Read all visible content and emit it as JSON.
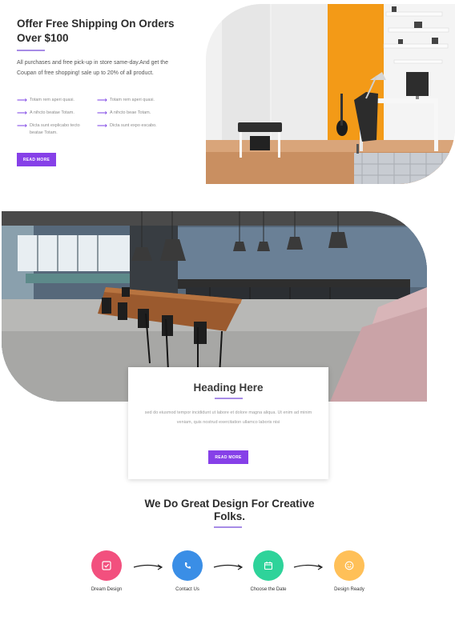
{
  "promo": {
    "title": "Offer Free Shipping On Orders Over $100",
    "description": "All purchases and free pick-up in store same-day.And get the Coupan of free shopping! sale up to 20% of all product.",
    "features": [
      {
        "text": "Totam rem aperi quasi."
      },
      {
        "text": "Totam rem aperi quasi."
      },
      {
        "text": "A nihcto beatae Totam."
      },
      {
        "text": "A nihcto beae Totam."
      },
      {
        "text": "Dicta sunt explicabo tecto beatae Totam."
      },
      {
        "text": "Dicta sunt expo escabo."
      }
    ],
    "button_label": "READ MORE"
  },
  "feature_card": {
    "title": "Heading Here",
    "text": "sed do eiusmod tempor incididunt ut labore et dolore magna aliqua. Ut enim ad minim veniam, quis nostrud exercitation ullamco laboris nisi",
    "button_label": "READ MORE"
  },
  "process": {
    "title": "We Do Great Design For Creative Folks.",
    "steps": [
      {
        "label": "Dream Design",
        "icon": "checkbox-icon",
        "color": "#f2507e"
      },
      {
        "label": "Contact Us",
        "icon": "phone-icon",
        "color": "#3a8ee6"
      },
      {
        "label": "Choose the Date",
        "icon": "calendar-icon",
        "color": "#2ed39a"
      },
      {
        "label": "Design Ready",
        "icon": "smile-icon",
        "color": "#ffc058"
      }
    ]
  },
  "colors": {
    "accent": "#8640e8",
    "rule": "#a78be6"
  }
}
